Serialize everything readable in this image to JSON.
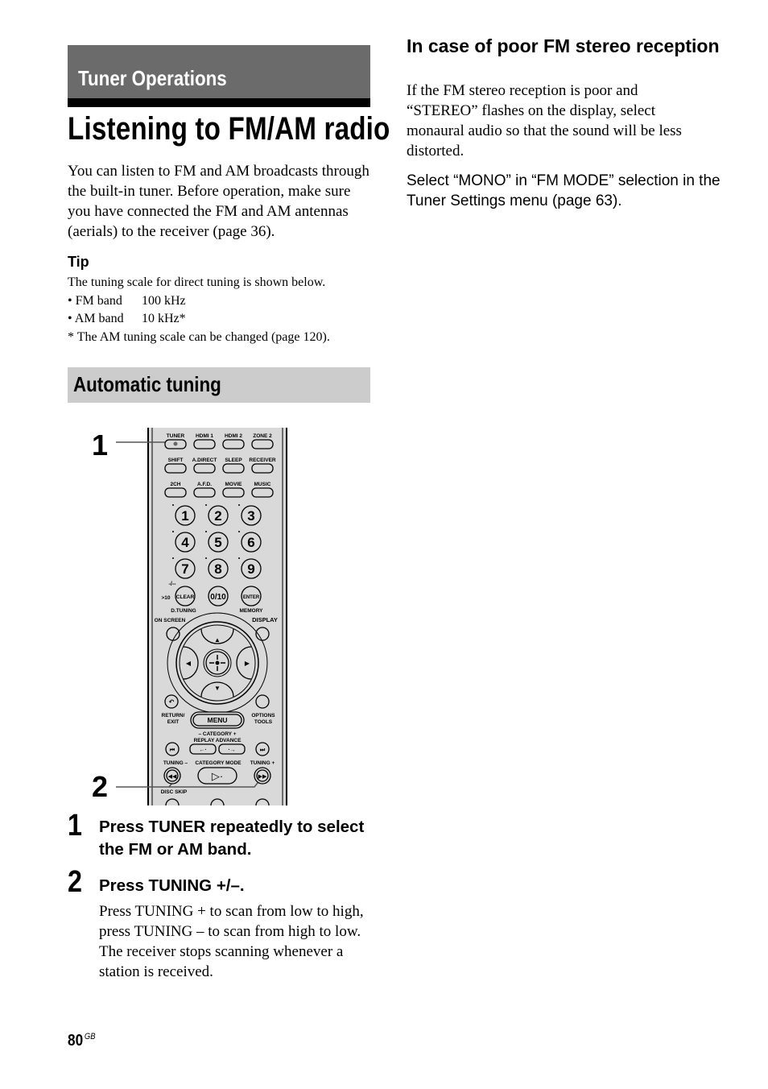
{
  "section": {
    "label": "Tuner Operations"
  },
  "page_title": "Listening to FM/AM radio",
  "intro": "You can listen to FM and AM broadcasts through the built-in tuner. Before operation, make sure you have connected the FM and AM antennas (aerials) to the receiver (page 36).",
  "tip": {
    "heading": "Tip",
    "lead": "The tuning scale for direct tuning is shown below.",
    "rows": [
      {
        "band": "• FM band",
        "value": "100 kHz"
      },
      {
        "band": "• AM band",
        "value": "10 kHz*"
      }
    ],
    "footnote": "* The AM tuning scale can be changed (page 120)."
  },
  "subsection": {
    "label": "Automatic tuning"
  },
  "remote": {
    "callouts": [
      "1",
      "2"
    ],
    "row1": [
      "TUNER",
      "HDMI 1",
      "HDMI 2",
      "ZONE 2"
    ],
    "row2": [
      "SHIFT",
      "A.DIRECT",
      "SLEEP",
      "RECEIVER"
    ],
    "row3": [
      "2CH",
      "A.F.D.",
      "MOVIE",
      "MUSIC"
    ],
    "numbers": [
      "1",
      "2",
      "3",
      "4",
      "5",
      "6",
      "7",
      "8",
      "9"
    ],
    "clear_label": "CLEAR",
    "zero_label": "0/10",
    "enter_label": "ENTER",
    "gt10_label": ">10",
    "dash_label": "-/--",
    "dtuning_label": "D.TUNING",
    "memory_label": "MEMORY",
    "onscreen_label": "ON SCREEN",
    "display_label": "DISPLAY",
    "return_label_1": "RETURN/",
    "return_label_2": "EXIT",
    "menu_label": "MENU",
    "options_label_1": "OPTIONS",
    "options_label_2": "TOOLS",
    "category_label": "–  CATEGORY  +",
    "replay_advance_label": "REPLAY  ADVANCE",
    "tuning_minus_label": "TUNING –",
    "category_mode_label": "CATEGORY MODE",
    "tuning_plus_label": "TUNING +",
    "disc_skip_label": "DISC SKIP"
  },
  "steps": [
    {
      "num": "1",
      "heading": "Press TUNER repeatedly to select the FM or AM band."
    },
    {
      "num": "2",
      "heading": "Press TUNING +/–.",
      "body_1": "Press TUNING + to scan from low to high, press TUNING – to scan from high to low.",
      "body_2": "The receiver stops scanning whenever a station is received."
    }
  ],
  "right": {
    "heading": "In case of poor FM stereo reception",
    "body": "If the FM stereo reception is poor and “STEREO” flashes on the display, select monaural audio so that the sound will be less distorted.",
    "instruction": "Select “MONO” in “FM MODE” selection in the Tuner Settings menu (page 63)."
  },
  "footer": {
    "page_number": "80",
    "region": "GB"
  }
}
